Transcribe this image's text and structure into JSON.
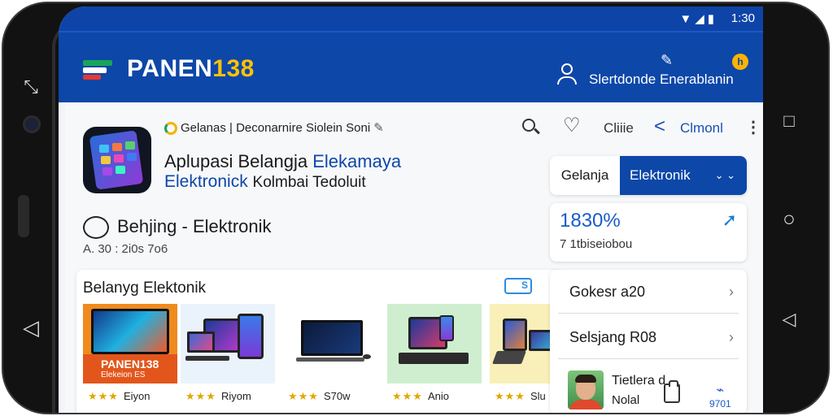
{
  "status_bar": {
    "icons": "▼◢▮",
    "time": "1:30"
  },
  "header": {
    "brand_text": "PANEN",
    "brand_num": "138",
    "account_link": "Slertdonde Enerablanin",
    "badge": "h"
  },
  "app": {
    "breadcrumb": "Gelanas | Deconarnire Siolein Soni",
    "title_line1_a": "Aplupasi Belangja ",
    "title_line1_b": "Elekamaya",
    "title_line2_a": "Elektronick ",
    "title_line2_b": "Kolmbai Tedoluit"
  },
  "toolbar": {
    "label_a": "Cliiie",
    "label_b": "Clmonl"
  },
  "category": {
    "label": "Behjing - Elektronik",
    "meta": "A. 30 : 2i0s 7o6"
  },
  "products": {
    "title": "Belanyg Elektonik",
    "badge": "S",
    "items": [
      {
        "brand_line1": "PANEN138",
        "brand_line2": "Elekeion ES",
        "stars": "★★★",
        "label": "Eiyon"
      },
      {
        "stars": "★★★",
        "label": "Riyom"
      },
      {
        "stars": "★★★",
        "label": "S70w"
      },
      {
        "stars": "★★★",
        "label": "Anio"
      },
      {
        "stars": "★★★",
        "label": "Slu"
      }
    ]
  },
  "segment": {
    "option_a": "Gelanja",
    "option_b": "Elektronik",
    "chevron": "⌄ ⌄"
  },
  "stat": {
    "value": "1830%",
    "sub": "7 1tbiseiobou"
  },
  "list": {
    "rows": [
      {
        "label": "Gokesr a20"
      },
      {
        "label": "Selsjang R08"
      }
    ],
    "profile_name": "Tietlera d",
    "profile_sub": "Nolal",
    "profile_tag": "9701"
  },
  "colors": {
    "brand_blue": "#0d47a8",
    "accent_yellow": "#ffc107",
    "link_blue": "#1a5cc8"
  }
}
